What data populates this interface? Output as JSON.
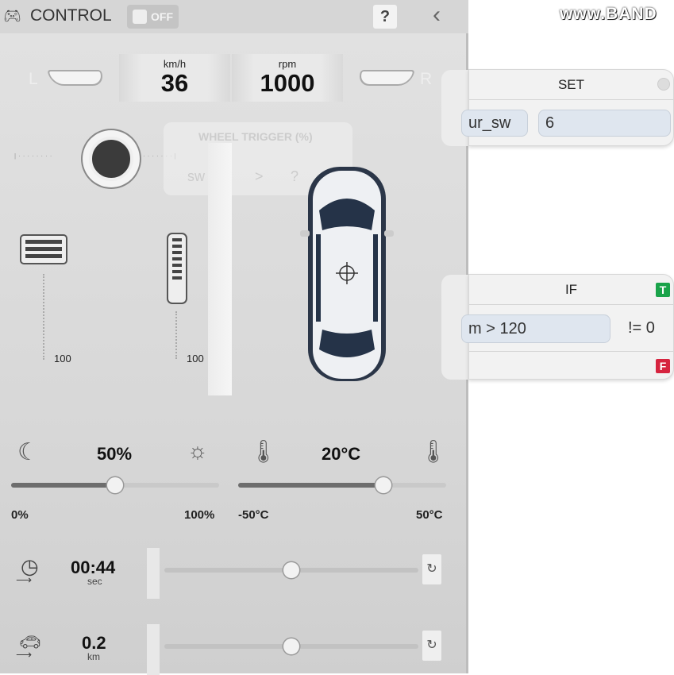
{
  "header": {
    "title": "CONTROL",
    "toggle_label": "OFF",
    "toggle_on": false,
    "help_label": "?",
    "back_icon": "chevron-left-icon",
    "gamepad_icon": "gamepad-icon"
  },
  "gauges": {
    "left_label": "L",
    "right_label": "R",
    "speed_unit": "km/h",
    "speed_value": "36",
    "rpm_unit": "rpm",
    "rpm_value": "1000"
  },
  "overlay": {
    "title": "WHEEL TRIGGER (%)",
    "left": "sw",
    "op": ">",
    "right": "?"
  },
  "pedals": {
    "brake_max": "100",
    "accel_max": "100"
  },
  "brightness": {
    "value": "50%",
    "min": "0%",
    "max": "100%",
    "percent": 50
  },
  "temperature": {
    "value": "20°C",
    "min": "-50°C",
    "max": "50°C",
    "current": 20,
    "range": [
      -50,
      50
    ]
  },
  "timer": {
    "value": "00:44",
    "unit": "sec",
    "percent": 50
  },
  "distance": {
    "value": "0.2",
    "unit": "km",
    "percent": 50
  },
  "script": {
    "set_node": {
      "title": "SET",
      "variable": "ur_sw",
      "value": "6"
    },
    "if_node": {
      "title": "IF",
      "condition": "m > 120",
      "suffix": "!= 0",
      "true_badge": "T",
      "false_badge": "F"
    }
  },
  "watermark": "www.BAND",
  "colors": {
    "true_badge": "#1aa34a",
    "false_badge": "#d6243f",
    "field_bg": "#dfe6ef"
  }
}
